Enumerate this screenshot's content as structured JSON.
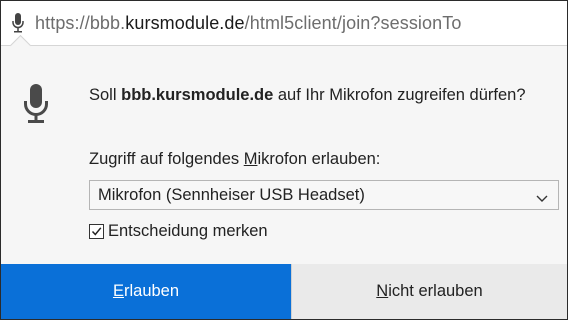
{
  "urlbar": {
    "icon": "microphone-icon",
    "url_prefix": "https://bbb.",
    "url_host": "kursmodule.de",
    "url_suffix": "/html5client/join?sessionTo"
  },
  "prompt": {
    "icon": "microphone-icon",
    "question_prefix": "Soll ",
    "question_host": "bbb.kursmodule.de",
    "question_suffix": " auf Ihr Mikrofon zugreifen dürfen?",
    "select_label_pre": "Zugriff auf folgendes ",
    "select_label_accel": "M",
    "select_label_post": "ikrofon erlauben:",
    "selected_device": "Mikrofon (Sennheiser USB Headset)",
    "remember_label": "Entscheidung merken",
    "remember_checked": true
  },
  "buttons": {
    "allow_accel": "E",
    "allow_rest": "rlauben",
    "deny_accel": "N",
    "deny_rest": "icht erlauben"
  },
  "colors": {
    "allow_button": "#0a70d8",
    "deny_button": "#eaeaea",
    "panel_background": "#f6f6f6"
  }
}
